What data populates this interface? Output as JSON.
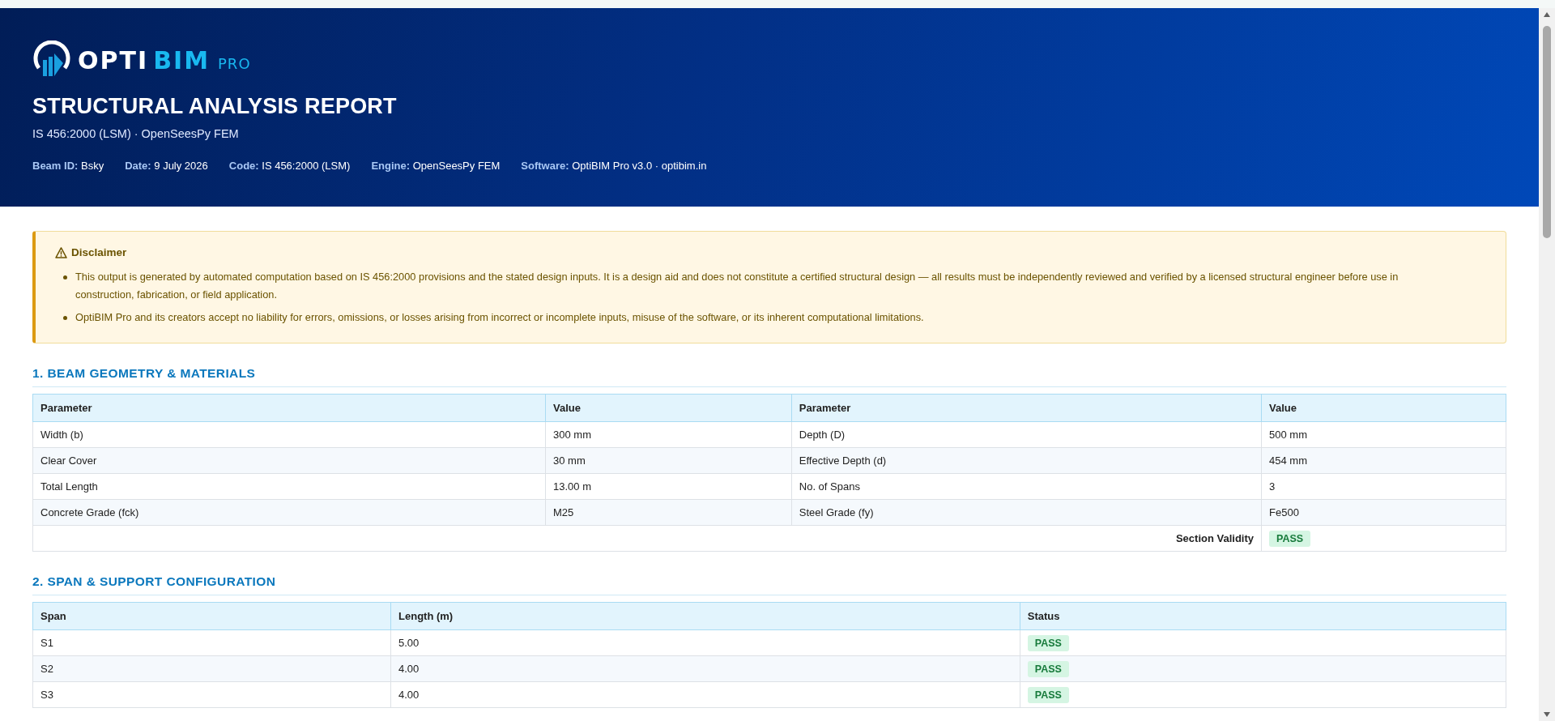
{
  "header": {
    "logo": {
      "part_1": "OPTI",
      "part_2": "BIM",
      "part_3": "PRO"
    },
    "title": "STRUCTURAL ANALYSIS REPORT",
    "subtitle": "IS 456:2000 (LSM) · OpenSeesPy FEM",
    "meta": [
      {
        "label": "Beam ID:",
        "value": "Bsky"
      },
      {
        "label": "Date:",
        "value": "9 July 2026"
      },
      {
        "label": "Code:",
        "value": "IS 456:2000 (LSM)"
      },
      {
        "label": "Engine:",
        "value": "OpenSeesPy FEM"
      },
      {
        "label": "Software:",
        "value": "OptiBIM Pro v3.0 · optibim.in"
      }
    ]
  },
  "disclaimer": {
    "title": "Disclaimer",
    "items": [
      "This output is generated by automated computation based on IS 456:2000 provisions and the stated design inputs. It is a design aid and does not constitute a certified structural design — all results must be independently reviewed and verified by a licensed structural engineer before use in construction, fabrication, or field application.",
      "OptiBIM Pro and its creators accept no liability for errors, omissions, or losses arising from incorrect or incomplete inputs, misuse of the software, or its inherent computational limitations."
    ]
  },
  "geometry": {
    "heading": "1. BEAM GEOMETRY & MATERIALS",
    "columns": [
      "Parameter",
      "Value",
      "Parameter",
      "Value"
    ],
    "rows": [
      [
        "Width (b)",
        "300 mm",
        "Depth (D)",
        "500 mm"
      ],
      [
        "Clear Cover",
        "30 mm",
        "Effective Depth (d)",
        "454 mm"
      ],
      [
        "Total Length",
        "13.00 m",
        "No. of Spans",
        "3"
      ],
      [
        "Concrete Grade (fck)",
        "M25",
        "Steel Grade (fy)",
        "Fe500"
      ]
    ],
    "validity": {
      "label": "Section Validity",
      "status": "PASS"
    }
  },
  "spans": {
    "heading": "2. SPAN & SUPPORT CONFIGURATION",
    "columns": [
      "Span",
      "Length (m)",
      "Status"
    ],
    "rows": [
      {
        "span": "S1",
        "length": "5.00",
        "status": "PASS"
      },
      {
        "span": "S2",
        "length": "4.00",
        "status": "PASS"
      },
      {
        "span": "S3",
        "length": "4.00",
        "status": "PASS"
      }
    ]
  }
}
